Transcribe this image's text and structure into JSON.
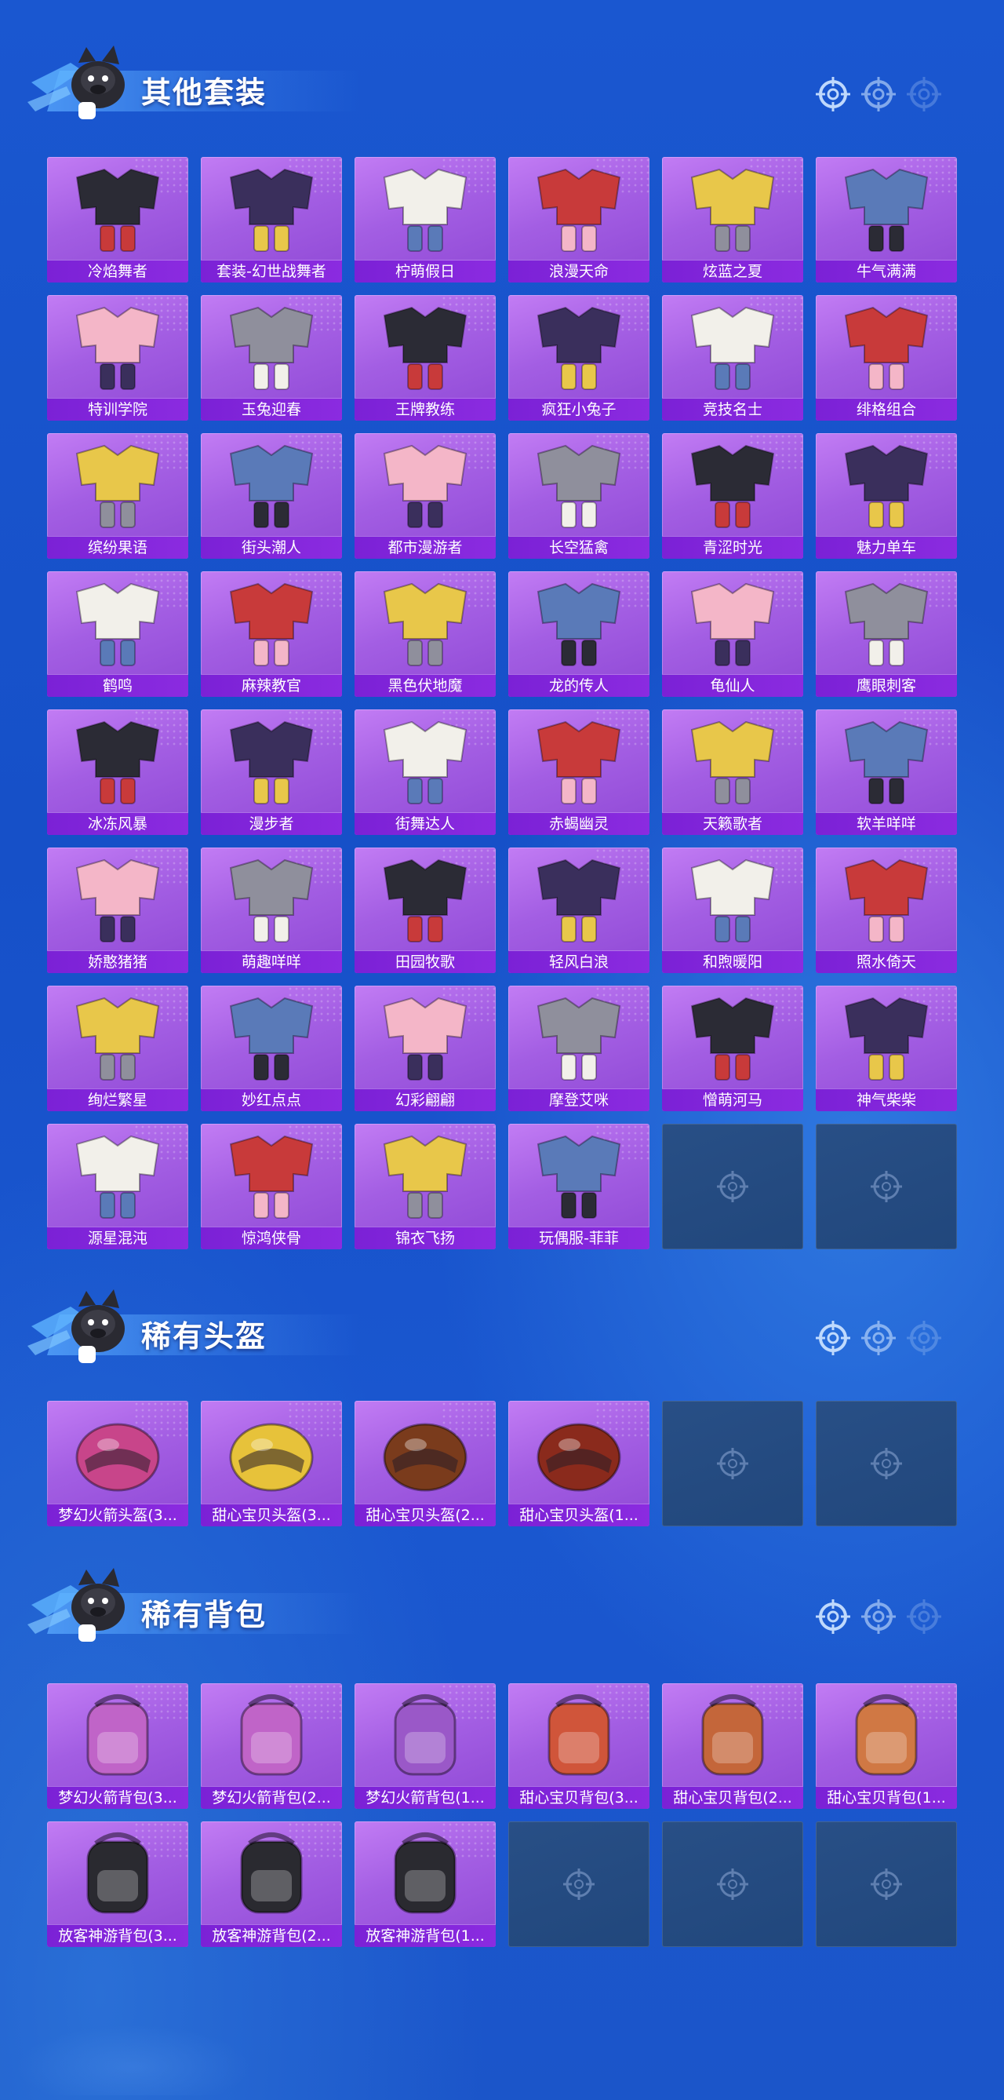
{
  "colors": {
    "background": "#1650c8",
    "card_purple": "#a35ee3",
    "label_purple": "#7b21d6",
    "empty_slot": "#244b80"
  },
  "sections": {
    "suits": {
      "title": "其他套装",
      "items": [
        "冷焰舞者",
        "套装-幻世战舞者",
        "柠萌假日",
        "浪漫天命",
        "炫蓝之夏",
        "牛气满满",
        "特训学院",
        "玉兔迎春",
        "王牌教练",
        "疯狂小兔子",
        "竞技名士",
        "绯格组合",
        "缤纷果语",
        "街头潮人",
        "都市漫游者",
        "长空猛禽",
        "青涩时光",
        "魅力单车",
        "鹤鸣",
        "麻辣教官",
        "黑色伏地魔",
        "龙的传人",
        "龟仙人",
        "鹰眼刺客",
        "冰冻风暴",
        "漫步者",
        "街舞达人",
        "赤蝎幽灵",
        "天籁歌者",
        "软羊咩咩",
        "娇憨猪猪",
        "萌趣咩咩",
        "田园牧歌",
        "轻风白浪",
        "和煦暖阳",
        "照水倚天",
        "绚烂繁星",
        "妙红点点",
        "幻彩翩翩",
        "摩登艾咪",
        "憎萌河马",
        "神气柴柴",
        "源星混沌",
        "惊鸿侠骨",
        "锦衣飞扬",
        "玩偶服-菲菲"
      ],
      "empty_slots": 2
    },
    "helmets": {
      "title": "稀有头盔",
      "items": [
        "梦幻火箭头盔(3...",
        "甜心宝贝头盔(3...",
        "甜心宝贝头盔(2...",
        "甜心宝贝头盔(1..."
      ],
      "empty_slots": 2
    },
    "backpacks": {
      "title": "稀有背包",
      "items": [
        "梦幻火箭背包(3...",
        "梦幻火箭背包(2...",
        "梦幻火箭背包(1...",
        "甜心宝贝背包(3...",
        "甜心宝贝背包(2...",
        "甜心宝贝背包(1...",
        "放客神游背包(3...",
        "放客神游背包(2...",
        "放客神游背包(1..."
      ],
      "empty_slots": 3
    }
  }
}
